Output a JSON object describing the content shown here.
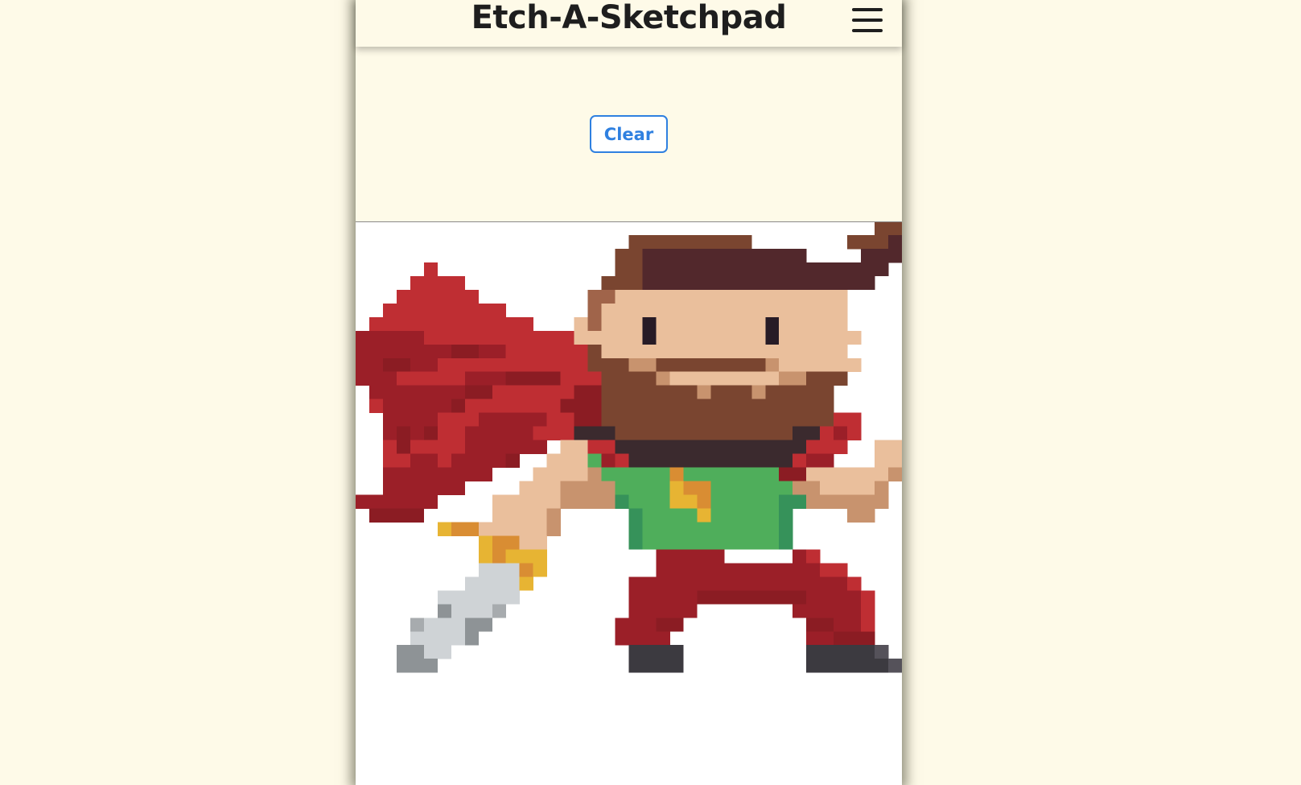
{
  "app": {
    "title": "Etch-A-Sketchpad",
    "menu_icon": "hamburger-menu-icon"
  },
  "controls": {
    "clear_label": "Clear"
  },
  "colors": {
    "background": "#fefae8",
    "accent": "#2f80e0",
    "canvas_background": "#ffffff"
  },
  "sketch": {
    "grid_size": 40,
    "palette": {
      "R": "#bf2e33",
      "D": "#9b1f28",
      "M": "#8b1c23",
      "H": "#7a4530",
      "h": "#52282c",
      "S": "#eabf9c",
      "s": "#c8936e",
      "e": "#271b26",
      "p": "#a0644a",
      "B": "#7a4530",
      "k": "#3b2a2e",
      "G": "#4fae5b",
      "g": "#36925a",
      "Y": "#e7b433",
      "O": "#d98d33",
      "L": "#cfd3d6",
      "l": "#a7abae",
      "n": "#8e9396",
      "X": "#3c3a40",
      "x": "#55525a"
    },
    "rows": [
      "......................................HH",
      "....................HHHHHHHHH.......HHHh",
      "...................HHhhhhhhhhhhhh....hhhh",
      ".....R.............HHhhhhhhhhhhhhhhhhhh.",
      "....RRRR..........HHHhhhhhhhhhhhhhhhhh..",
      "...RRRRRR........ppSSSSSSSSSSSSSSSSS....",
      "..RRRRRRRRR......pSSSSSSSSSSSSSSSSSS....",
      ".RRRRRRRRRRRR...SpSSSeSSSSSSSSeSSSSS....",
      "DDDDDRRRRRRRRRRRSSSSSeSSSSSSSSeSSSSSS...",
      "DDDDDDDMMDDRRRRRRBSSSSSSSSSSSSSSSSSS....",
      "DDMMDDRRRRRRRRRRRBBBssBBBBBBBBsSSSSSS...",
      "DDDRRRRRDDDMMMMRRRBBBBsSSSSSSSSssBBB....",
      ".DDDDDDDMMRRRRRRMMBBBBBBBsBBBsBBBBB.....",
      ".RDDDDDMRRRRRRRMMMBBBBBBBBBBBBBBBBB.....",
      "..DDDDRRRDDDDDRRMMBBBBBBBBBBBBBBBBBRR...",
      "..DMDMRRDDDDDRRRkkkBBBBBBBBBBBBBkkRDR...",
      "..RMRRRRDDDDDD.SSRRkkkkkkkkkkkkkkRRR..SS",
      "..RRDDRDDDDM..SSSGDRkkkkkkkkkkkkRDD...SS",
      "..DDDDDDDD...SSSSsGGGGGOGGGGGGGMMSSSSSSs",
      "..DDDDDD....SSSssssGGGGYOOGGGGGGssSSSSs.",
      "DDDDDD....SSSSSssssgGGGYYOGGGGGggssssss.",
      ".MMMM.....SSSSs.....gGGGGYGGGGGg....ss..",
      "......YOOSSSSSs.....gGGGGGGGGGGg........",
      ".........YOOSS......gGGGGGGGGGGg........",
      ".........YOYYY........DDDDD.....DR......",
      ".........LLLOY........DDDDDDDDDDDDRR....",
      "........LLLLY.......DDDDDDDDDDDDDDDDR...",
      "......LLLLLL........DDDDDMMMMMMMMDDDDR...",
      "......nLLLl.........DDDDD.......DDDDDR..",
      "....lLLLnn.........DDDMM.........MMDDR..",
      "....LLLLn..........DDDD..........DDMMM..",
      "...nnLL.............XXXX.........XXXXXx.",
      "...nnn..............XXXX.........XXXXXXx",
      "........................................",
      "........................................",
      "........................................",
      "........................................",
      "........................................",
      "........................................",
      "........................................"
    ]
  }
}
